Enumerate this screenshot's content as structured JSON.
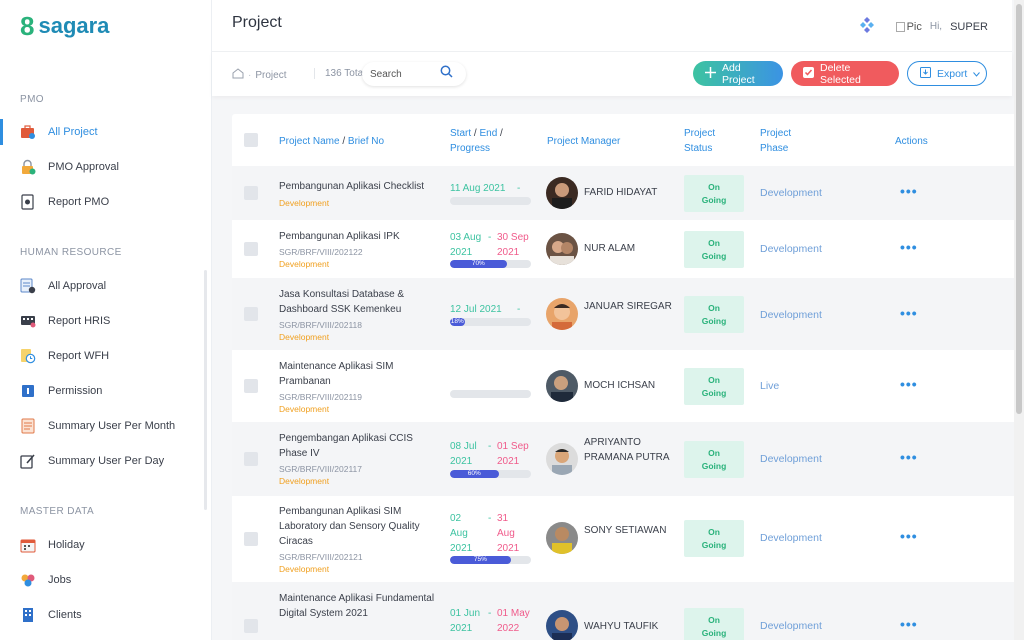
{
  "brand": {
    "mark": "8",
    "name": "sagara"
  },
  "sidebar": {
    "sections": [
      {
        "title": "PMO",
        "items": [
          {
            "label": "All Project",
            "icon": "briefcase-icon",
            "active": true
          },
          {
            "label": "PMO Approval",
            "icon": "lock-check-icon"
          },
          {
            "label": "Report PMO",
            "icon": "document-gear-icon"
          }
        ]
      },
      {
        "title": "HUMAN RESOURCE",
        "items": [
          {
            "label": "All Approval",
            "icon": "approval-doc-icon"
          },
          {
            "label": "Report HRIS",
            "icon": "keyboard-report-icon"
          },
          {
            "label": "Report WFH",
            "icon": "clock-doc-icon"
          },
          {
            "label": "Permission",
            "icon": "permission-icon"
          },
          {
            "label": "Summary User Per Month",
            "icon": "notepad-icon"
          },
          {
            "label": "Summary User Per Day",
            "icon": "edit-note-icon"
          }
        ]
      },
      {
        "title": "MASTER DATA",
        "items": [
          {
            "label": "Holiday",
            "icon": "calendar-icon"
          },
          {
            "label": "Jobs",
            "icon": "jobs-icon"
          },
          {
            "label": "Clients",
            "icon": "building-icon"
          }
        ]
      }
    ]
  },
  "header": {
    "title": "Project",
    "pic_alt": "Pic",
    "greeting": "Hi,",
    "user": "SUPER"
  },
  "toolbar": {
    "breadcrumb": "Project",
    "total": "136 Total",
    "search_placeholder": "Search",
    "add_label": "Add Project",
    "delete_label": "Delete Selected",
    "export_label": "Export"
  },
  "table": {
    "headers": {
      "name": "Project Name",
      "brief": "Brief No",
      "start": "Start",
      "end": "End",
      "progress": "Progress",
      "manager": "Project Manager",
      "status": "Project Status",
      "phase": "Project Phase",
      "actions": "Actions"
    },
    "rows": [
      {
        "name": "Pembangunan Aplikasi Checklist",
        "brief": "",
        "tag": "Development",
        "start_a": "11 Aug 2021",
        "start_b": "",
        "end_a": "",
        "end_b": "",
        "progress": 0,
        "progress_label": "",
        "manager": "FARID HIDAYAT",
        "status": "On Going",
        "phase": "Development"
      },
      {
        "name": "Pembangunan Aplikasi IPK",
        "brief": "SGR/BRF/VIII/202122",
        "tag": "Development",
        "start_a": "03 Aug",
        "start_b": "2021",
        "end_a": "30 Sep",
        "end_b": "2021",
        "progress": 70,
        "progress_label": "70%",
        "manager": "NUR ALAM",
        "status": "On Going",
        "phase": "Development"
      },
      {
        "name": "Jasa Konsultasi Database & Dashboard SSK Kemenkeu",
        "brief": "SGR/BRF/VIII/202118",
        "tag": "Development",
        "start_a": "12 Jul 2021",
        "start_b": "",
        "end_a": "",
        "end_b": "",
        "progress": 18,
        "progress_label": "18%",
        "manager": "JANUAR SIREGAR",
        "status": "On Going",
        "phase": "Development"
      },
      {
        "name": "Maintenance Aplikasi SIM Prambanan",
        "brief": "SGR/BRF/VIII/202119",
        "tag": "Development",
        "start_a": "",
        "start_b": "",
        "end_a": "",
        "end_b": "",
        "progress": 0,
        "progress_label": "",
        "manager": "MOCH ICHSAN",
        "status": "On Going",
        "phase": "Live"
      },
      {
        "name": "Pengembangan Aplikasi CCIS Phase IV",
        "brief": "SGR/BRF/VIII/202117",
        "tag": "Development",
        "start_a": "08 Jul",
        "start_b": "2021",
        "end_a": "01 Sep",
        "end_b": "2021",
        "progress": 60,
        "progress_label": "60%",
        "manager": "APRIYANTO PRAMANA PUTRA",
        "status": "On Going",
        "phase": "Development"
      },
      {
        "name": "Pembangunan Aplikasi SIM Laboratory dan Sensory Quality Ciracas",
        "brief": "SGR/BRF/VIII/202121",
        "tag": "Development",
        "start_a": "02 Aug",
        "start_b": "2021",
        "end_a": "31 Aug",
        "end_b": "2021",
        "progress": 75,
        "progress_label": "75%",
        "manager": "SONY SETIAWAN",
        "status": "On Going",
        "phase": "Development"
      },
      {
        "name": "Maintenance Aplikasi Fundamental Digital System 2021",
        "brief": "",
        "tag": "",
        "start_a": "01 Jun",
        "start_b": "2021",
        "end_a": "01 May",
        "end_b": "2022",
        "progress": 0,
        "progress_label": "",
        "manager": "WAHYU TAUFIK",
        "status": "On Going",
        "phase": "Development"
      }
    ]
  },
  "colors": {
    "accent": "#2f8ee0",
    "brand_green": "#2ab27b",
    "danger": "#f05b5e",
    "progress": "#4a5bd8"
  }
}
